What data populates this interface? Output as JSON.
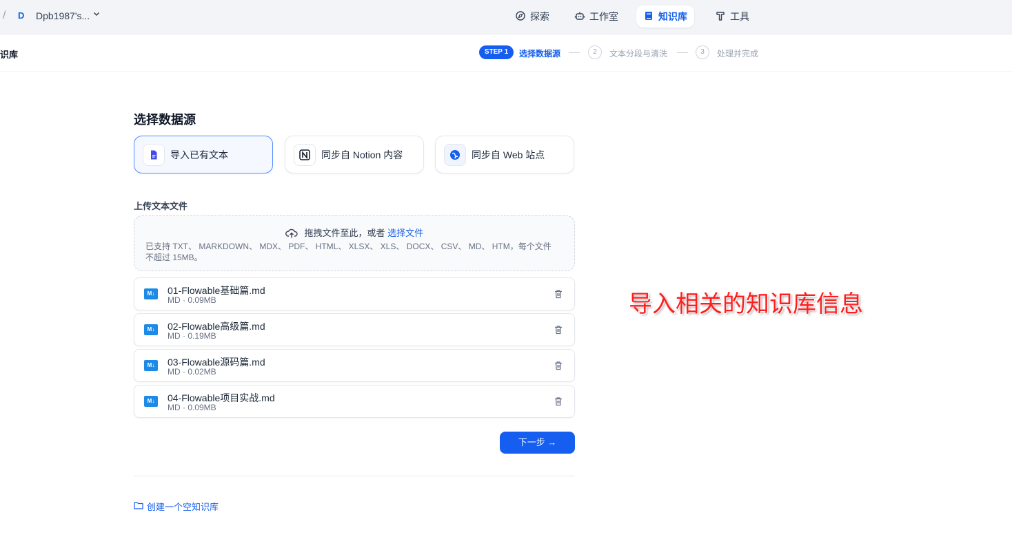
{
  "workspace": {
    "separator": "/",
    "avatar_letter": "D",
    "name": "Dpb1987's..."
  },
  "nav": {
    "explore": "探索",
    "studio": "工作室",
    "knowledge": "知识库",
    "tools": "工具",
    "active": "knowledge"
  },
  "header": {
    "page_crumb": "识库"
  },
  "steps": {
    "step1_badge": "STEP 1",
    "step1_label": "选择数据源",
    "step2_num": "2",
    "step2_label": "文本分段与清洗",
    "step3_num": "3",
    "step3_label": "处理并完成"
  },
  "data_source": {
    "title": "选择数据源",
    "options": [
      {
        "label": "导入已有文本",
        "icon": "document-icon",
        "selected": true
      },
      {
        "label": "同步自 Notion 内容",
        "icon": "notion-icon",
        "selected": false
      },
      {
        "label": "同步自 Web 站点",
        "icon": "web-icon",
        "selected": false
      }
    ]
  },
  "upload": {
    "label": "上传文本文件",
    "drop_text": "拖拽文件至此，或者",
    "select_link": "选择文件",
    "hint": "已支持 TXT、 MARKDOWN、 MDX、 PDF、 HTML、 XLSX、 XLS、 DOCX、 CSV、 MD、 HTM，每个文件不超过 15MB。"
  },
  "files": [
    {
      "icon_text": "M↓",
      "name": "01-Flowable基础篇.md",
      "meta": "MD · 0.09MB"
    },
    {
      "icon_text": "M↓",
      "name": "02-Flowable高级篇.md",
      "meta": "MD · 0.19MB"
    },
    {
      "icon_text": "M↓",
      "name": "03-Flowable源码篇.md",
      "meta": "MD · 0.02MB"
    },
    {
      "icon_text": "M↓",
      "name": "04-Flowable项目实战.md",
      "meta": "MD · 0.09MB"
    }
  ],
  "next_button": "下一步 →",
  "create_empty": "创建一个空知识库",
  "annotation": "导入相关的知识库信息",
  "colors": {
    "primary": "#155eef",
    "annotation": "#ff1e1e",
    "md_icon": "#1d8ae8"
  }
}
